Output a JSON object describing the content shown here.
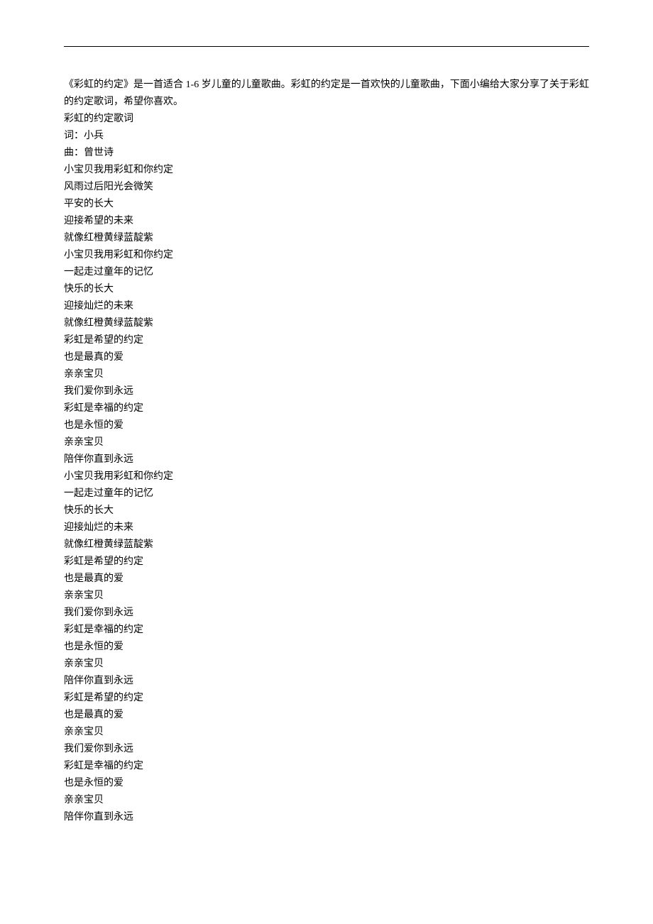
{
  "intro": "《彩虹的约定》是一首适合 1-6 岁儿童的儿童歌曲。彩虹的约定是一首欢快的儿童歌曲，下面小编给大家分享了关于彩虹的约定歌词，希望你喜欢。",
  "lines": [
    "彩虹的约定歌词",
    "词：小兵",
    "曲：曾世诗",
    "小宝贝我用彩虹和你约定",
    "风雨过后阳光会微笑",
    "平安的长大",
    "迎接希望的未来",
    "就像红橙黄绿蓝靛紫",
    "小宝贝我用彩虹和你约定",
    "一起走过童年的记忆",
    "快乐的长大",
    "迎接灿烂的未来",
    "就像红橙黄绿蓝靛紫",
    "彩虹是希望的约定",
    "也是最真的爱",
    "亲亲宝贝",
    "我们爱你到永远",
    "彩虹是幸福的约定",
    "也是永恒的爱",
    "亲亲宝贝",
    "陪伴你直到永远",
    "小宝贝我用彩虹和你约定",
    "一起走过童年的记忆",
    "快乐的长大",
    "迎接灿烂的未来",
    "就像红橙黄绿蓝靛紫",
    "彩虹是希望的约定",
    "也是最真的爱",
    "亲亲宝贝",
    "我们爱你到永远",
    "彩虹是幸福的约定",
    "也是永恒的爱",
    "亲亲宝贝",
    "陪伴你直到永远",
    "彩虹是希望的约定",
    "也是最真的爱",
    "亲亲宝贝",
    "我们爱你到永远",
    "彩虹是幸福的约定",
    "也是永恒的爱",
    "亲亲宝贝",
    "陪伴你直到永远"
  ]
}
